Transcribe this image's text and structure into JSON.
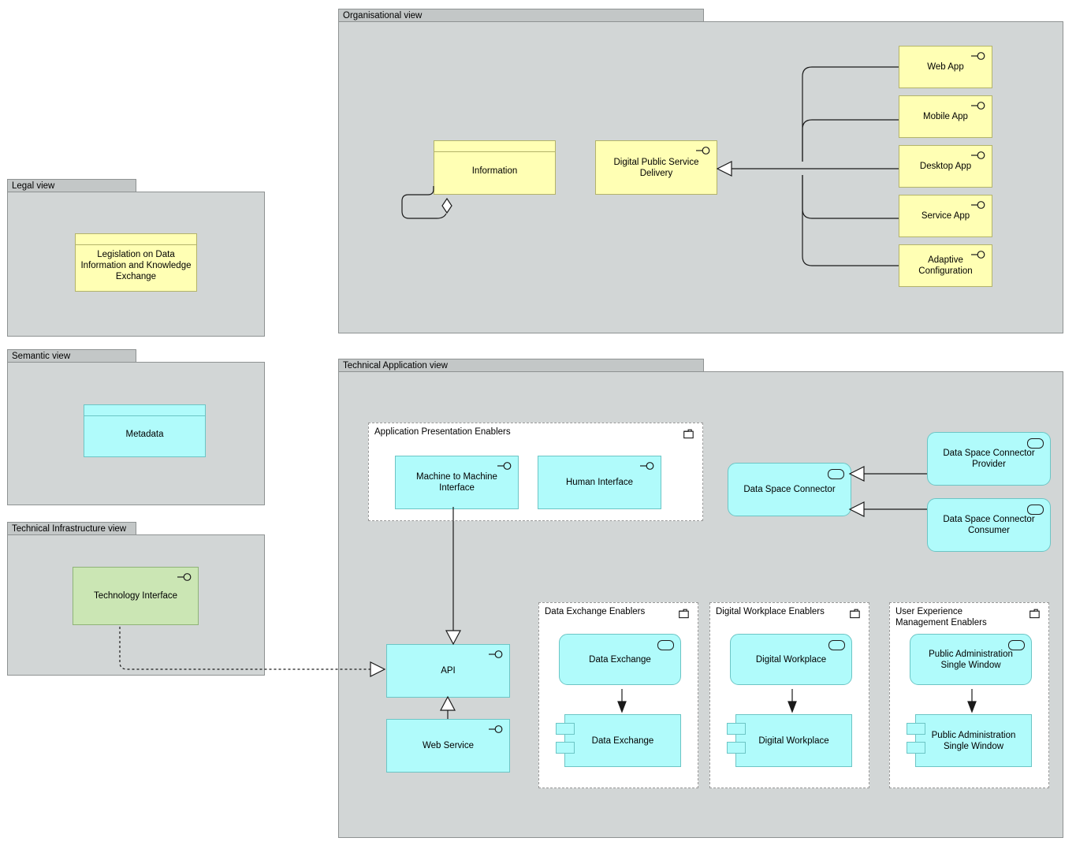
{
  "views": {
    "legal": {
      "title": "Legal view"
    },
    "semantic": {
      "title": "Semantic view"
    },
    "infrastructure": {
      "title": "Technical Infrastructure view"
    },
    "organisational": {
      "title": "Organisational view"
    },
    "technical_application": {
      "title": "Technical Application view"
    }
  },
  "groupings": {
    "presentation_enablers": {
      "title": "Application Presentation Enablers"
    },
    "data_exchange_enablers": {
      "title": "Data Exchange Enablers"
    },
    "digital_workplace_enablers": {
      "title": "Digital Workplace Enablers"
    },
    "ux_management_enablers": {
      "title": "User Experience Management Enablers"
    }
  },
  "elements": {
    "legislation": {
      "label": "Legislation on Data Information and Knowledge Exchange",
      "type": "business-object",
      "color": "#ffffb4"
    },
    "metadata": {
      "label": "Metadata",
      "type": "data-object",
      "color": "#b0fbfb"
    },
    "technology_interface": {
      "label": "Technology Interface",
      "type": "technology-interface",
      "color": "#cbe6b4"
    },
    "information": {
      "label": "Information",
      "type": "business-object",
      "color": "#ffffb4"
    },
    "digital_public_service_delivery": {
      "label": "Digital Public Service Delivery",
      "type": "business-interface",
      "color": "#ffffb4"
    },
    "web_app": {
      "label": "Web App",
      "type": "business-interface",
      "color": "#ffffb4"
    },
    "mobile_app": {
      "label": "Mobile App",
      "type": "business-interface",
      "color": "#ffffb4"
    },
    "desktop_app": {
      "label": "Desktop App",
      "type": "business-interface",
      "color": "#ffffb4"
    },
    "service_app": {
      "label": "Service App",
      "type": "business-interface",
      "color": "#ffffb4"
    },
    "adaptive_configuration": {
      "label": "Adaptive Configuration",
      "type": "business-interface",
      "color": "#ffffb4"
    },
    "machine_to_machine_interface": {
      "label": "Machine to Machine Interface",
      "type": "application-interface",
      "color": "#b0fbfb"
    },
    "human_interface": {
      "label": "Human Interface",
      "type": "application-interface",
      "color": "#b0fbfb"
    },
    "api": {
      "label": "API",
      "type": "application-interface",
      "color": "#b0fbfb"
    },
    "web_service": {
      "label": "Web Service",
      "type": "application-interface",
      "color": "#b0fbfb"
    },
    "data_space_connector": {
      "label": "Data Space Connector",
      "type": "application-service",
      "color": "#b0fbfb"
    },
    "data_space_connector_provider": {
      "label": "Data Space Connector Provider",
      "type": "application-service",
      "color": "#b0fbfb"
    },
    "data_space_connector_consumer": {
      "label": "Data Space Connector Consumer",
      "type": "application-service",
      "color": "#b0fbfb"
    },
    "data_exchange_service": {
      "label": "Data Exchange",
      "type": "application-service",
      "color": "#b0fbfb"
    },
    "data_exchange_component": {
      "label": "Data Exchange",
      "type": "application-component",
      "color": "#b0fbfb"
    },
    "digital_workplace_service": {
      "label": "Digital Workplace",
      "type": "application-service",
      "color": "#b0fbfb"
    },
    "digital_workplace_component": {
      "label": "Digital Workplace",
      "type": "application-component",
      "color": "#b0fbfb"
    },
    "pa_single_window_service": {
      "label": "Public Administration Single Window",
      "type": "application-service",
      "color": "#b0fbfb"
    },
    "pa_single_window_component": {
      "label": "Public Administration Single Window",
      "type": "application-component",
      "color": "#b0fbfb"
    }
  },
  "palette": {
    "business_yellow": "#ffffb4",
    "application_cyan": "#b0fbfb",
    "technology_green": "#cbe6b4",
    "view_background": "#d2d6d6",
    "view_tab": "#c3c7c7",
    "line": "#1a1a1a"
  }
}
